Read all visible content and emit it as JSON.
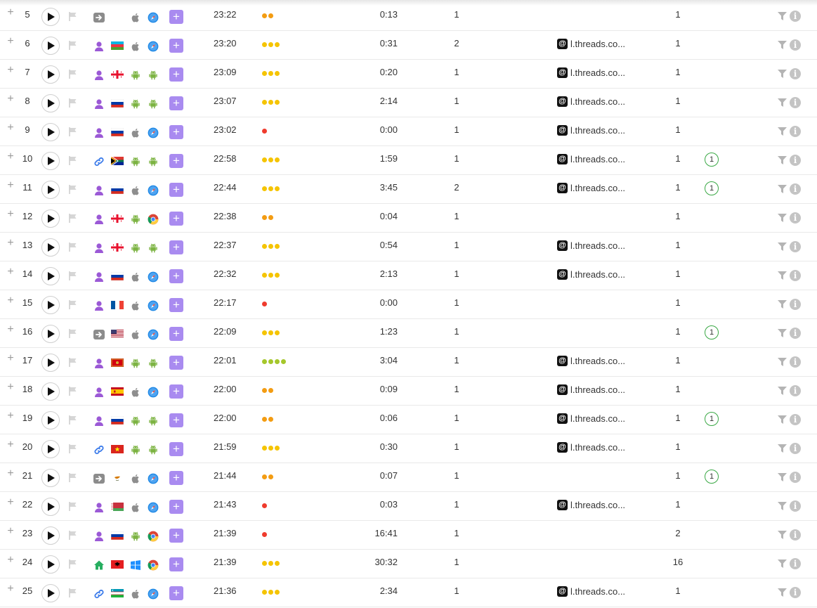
{
  "colors": {
    "accent": "#a98bf0",
    "dot_red": "#ef3b2d",
    "dot_orange": "#f39c12",
    "dot_yellow": "#f5c400",
    "dot_green": "#a5c72b",
    "badge_border": "#3aa845"
  },
  "rows": [
    {
      "num": "5",
      "src": "direct",
      "country": "none",
      "os": "apple",
      "browser": "safari",
      "time": "23:22",
      "dots": 2,
      "dotColor": "orange",
      "duration": "0:13",
      "pages": "1",
      "ref": "",
      "visits": "1",
      "badge": ""
    },
    {
      "num": "6",
      "src": "person",
      "country": "az",
      "os": "apple",
      "browser": "safari",
      "time": "23:20",
      "dots": 3,
      "dotColor": "yellow",
      "duration": "0:31",
      "pages": "2",
      "ref": "l.threads.co...",
      "visits": "1",
      "badge": ""
    },
    {
      "num": "7",
      "src": "person",
      "country": "ge",
      "os": "android",
      "browser": "android",
      "time": "23:09",
      "dots": 3,
      "dotColor": "yellow",
      "duration": "0:20",
      "pages": "1",
      "ref": "l.threads.co...",
      "visits": "1",
      "badge": ""
    },
    {
      "num": "8",
      "src": "person",
      "country": "ru",
      "os": "android",
      "browser": "android",
      "time": "23:07",
      "dots": 3,
      "dotColor": "yellow",
      "duration": "2:14",
      "pages": "1",
      "ref": "l.threads.co...",
      "visits": "1",
      "badge": ""
    },
    {
      "num": "9",
      "src": "person",
      "country": "ru",
      "os": "apple",
      "browser": "safari",
      "time": "23:02",
      "dots": 1,
      "dotColor": "red",
      "duration": "0:00",
      "pages": "1",
      "ref": "l.threads.co...",
      "visits": "1",
      "badge": ""
    },
    {
      "num": "10",
      "src": "link",
      "country": "za",
      "os": "android",
      "browser": "android",
      "time": "22:58",
      "dots": 3,
      "dotColor": "yellow",
      "duration": "1:59",
      "pages": "1",
      "ref": "l.threads.co...",
      "visits": "1",
      "badge": "1"
    },
    {
      "num": "11",
      "src": "person",
      "country": "ru",
      "os": "apple",
      "browser": "safari",
      "time": "22:44",
      "dots": 3,
      "dotColor": "yellow",
      "duration": "3:45",
      "pages": "2",
      "ref": "l.threads.co...",
      "visits": "1",
      "badge": "1"
    },
    {
      "num": "12",
      "src": "person",
      "country": "ge",
      "os": "android",
      "browser": "chrome",
      "time": "22:38",
      "dots": 2,
      "dotColor": "orange",
      "duration": "0:04",
      "pages": "1",
      "ref": "",
      "visits": "1",
      "badge": ""
    },
    {
      "num": "13",
      "src": "person",
      "country": "ge",
      "os": "android",
      "browser": "android",
      "time": "22:37",
      "dots": 3,
      "dotColor": "yellow",
      "duration": "0:54",
      "pages": "1",
      "ref": "l.threads.co...",
      "visits": "1",
      "badge": ""
    },
    {
      "num": "14",
      "src": "person",
      "country": "ru",
      "os": "apple",
      "browser": "safari",
      "time": "22:32",
      "dots": 3,
      "dotColor": "yellow",
      "duration": "2:13",
      "pages": "1",
      "ref": "l.threads.co...",
      "visits": "1",
      "badge": ""
    },
    {
      "num": "15",
      "src": "person",
      "country": "fr",
      "os": "apple",
      "browser": "safari",
      "time": "22:17",
      "dots": 1,
      "dotColor": "red",
      "duration": "0:00",
      "pages": "1",
      "ref": "",
      "visits": "1",
      "badge": ""
    },
    {
      "num": "16",
      "src": "direct",
      "country": "us",
      "os": "apple",
      "browser": "safari",
      "time": "22:09",
      "dots": 3,
      "dotColor": "yellow",
      "duration": "1:23",
      "pages": "1",
      "ref": "",
      "visits": "1",
      "badge": "1"
    },
    {
      "num": "17",
      "src": "person",
      "country": "me",
      "os": "android",
      "browser": "android",
      "time": "22:01",
      "dots": 4,
      "dotColor": "green",
      "duration": "3:04",
      "pages": "1",
      "ref": "l.threads.co...",
      "visits": "1",
      "badge": ""
    },
    {
      "num": "18",
      "src": "person",
      "country": "es",
      "os": "apple",
      "browser": "safari",
      "time": "22:00",
      "dots": 2,
      "dotColor": "orange",
      "duration": "0:09",
      "pages": "1",
      "ref": "l.threads.co...",
      "visits": "1",
      "badge": ""
    },
    {
      "num": "19",
      "src": "person",
      "country": "ru",
      "os": "android",
      "browser": "android",
      "time": "22:00",
      "dots": 2,
      "dotColor": "orange",
      "duration": "0:06",
      "pages": "1",
      "ref": "l.threads.co...",
      "visits": "1",
      "badge": "1"
    },
    {
      "num": "20",
      "src": "link",
      "country": "vn",
      "os": "android",
      "browser": "android",
      "time": "21:59",
      "dots": 3,
      "dotColor": "yellow",
      "duration": "0:30",
      "pages": "1",
      "ref": "l.threads.co...",
      "visits": "1",
      "badge": ""
    },
    {
      "num": "21",
      "src": "direct",
      "country": "cy",
      "os": "apple",
      "browser": "safari",
      "time": "21:44",
      "dots": 2,
      "dotColor": "orange",
      "duration": "0:07",
      "pages": "1",
      "ref": "",
      "visits": "1",
      "badge": "1"
    },
    {
      "num": "22",
      "src": "person",
      "country": "by",
      "os": "apple",
      "browser": "safari",
      "time": "21:43",
      "dots": 1,
      "dotColor": "red",
      "duration": "0:03",
      "pages": "1",
      "ref": "l.threads.co...",
      "visits": "1",
      "badge": ""
    },
    {
      "num": "23",
      "src": "person",
      "country": "ru",
      "os": "android",
      "browser": "chrome",
      "time": "21:39",
      "dots": 1,
      "dotColor": "red",
      "duration": "16:41",
      "pages": "1",
      "ref": "",
      "visits": "2",
      "badge": ""
    },
    {
      "num": "24",
      "src": "home",
      "country": "al",
      "os": "windows",
      "browser": "chrome",
      "time": "21:39",
      "dots": 3,
      "dotColor": "yellow",
      "duration": "30:32",
      "pages": "1",
      "ref": "",
      "visits": "16",
      "badge": ""
    },
    {
      "num": "25",
      "src": "link",
      "country": "uz",
      "os": "apple",
      "browser": "safari",
      "time": "21:36",
      "dots": 3,
      "dotColor": "yellow",
      "duration": "2:34",
      "pages": "1",
      "ref": "l.threads.co...",
      "visits": "1",
      "badge": ""
    }
  ]
}
